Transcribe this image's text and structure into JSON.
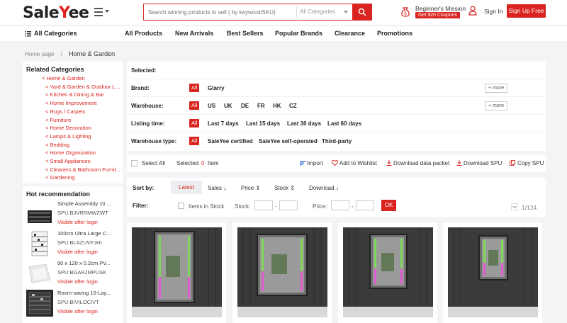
{
  "header": {
    "logo_text_a": "Sale",
    "logo_text_b": "Y",
    "logo_text_c": "ee",
    "search_placeholder": "Search winning products to sell ( by keyword/SKU)",
    "search_category": "All Categories",
    "mission_title": "Beginner's Mission",
    "coupon_label": "Get $20 Coupons",
    "signin_label": "Sign In",
    "signup_label": "Sign Up Free"
  },
  "nav": {
    "all_categories": "All Categories",
    "items": [
      "All Products",
      "New Arrivals",
      "Best Sellers",
      "Popular Brands",
      "Clearance",
      "Promotions"
    ]
  },
  "breadcrumb": {
    "home": "Home page",
    "sep": "/",
    "current": "Home & Garden"
  },
  "sidebar": {
    "related_title": "Related Categories",
    "categories": [
      "< Home & Garden",
      "< Yard & Garden & Outdoor Li...",
      "< Kitchen & Dining & Bar",
      "< Home Improvement",
      "< Rugs / Carpets",
      "< Furniture",
      "< Home Decoration",
      "< Lamps & Lighting",
      "< Bedding",
      "< Home Organization",
      "< Small Appliances",
      "< Cleaners & Bathroom Furnit...",
      "< Gardening"
    ],
    "hot_title": "Hot recommendation",
    "hot_items": [
      {
        "title": "Simple Assembly 10 ...",
        "spu": "SPU:BJVRRMWZWT",
        "visible": "Visible after login"
      },
      {
        "title": "100cm Ultra Large C...",
        "spu": "SPU:BLAZUVFJHI",
        "visible": "Visible after login"
      },
      {
        "title": "90 x 120 x 0.2cm PV...",
        "spu": "SPU:BGARJMPUSK",
        "visible": "Visible after login"
      },
      {
        "title": "Room-saving 10-Lay...",
        "spu": "SPU:BIVILOCIVT",
        "visible": "Visible after login"
      }
    ]
  },
  "filters": {
    "selected_label": "Selected:",
    "all_label": "All",
    "more_label": "+ more",
    "brand_label": "Brand:",
    "brand_options": [
      "Glarry"
    ],
    "warehouse_label": "Warehouse:",
    "warehouse_options": [
      "US",
      "UK",
      "DE",
      "FR",
      "HK",
      "CZ"
    ],
    "listing_label": "Listing time:",
    "listing_options": [
      "Last 7 days",
      "Last 15 days",
      "Last 30 days",
      "Last 60 days"
    ],
    "wtype_label": "Warehouse type:",
    "wtype_options": [
      "SaleYee certified",
      "SaleYee self-operated",
      "Third-party"
    ]
  },
  "actions": {
    "select_all": "Select All",
    "selected": "Selected",
    "selected_count": "0",
    "item": "Item",
    "import": "Import",
    "wishlist": "Add to Wishlist",
    "download_packet": "Download data packet",
    "download_spu": "Download SPU",
    "copy_spu": "Copy SPU"
  },
  "sort": {
    "label": "Sort by:",
    "latest": "Latest",
    "sales": "Sales",
    "price": "Price",
    "stock": "Stock",
    "download": "Download",
    "filter_label": "Filter:",
    "in_stock": "Items in Stock",
    "stock_label": "Stock:",
    "price_label": "Price:",
    "dash": "-",
    "ok": "OK",
    "pager": "1/124"
  },
  "colors": {
    "accent": "#d9241f",
    "background": "#f3f4f6"
  }
}
